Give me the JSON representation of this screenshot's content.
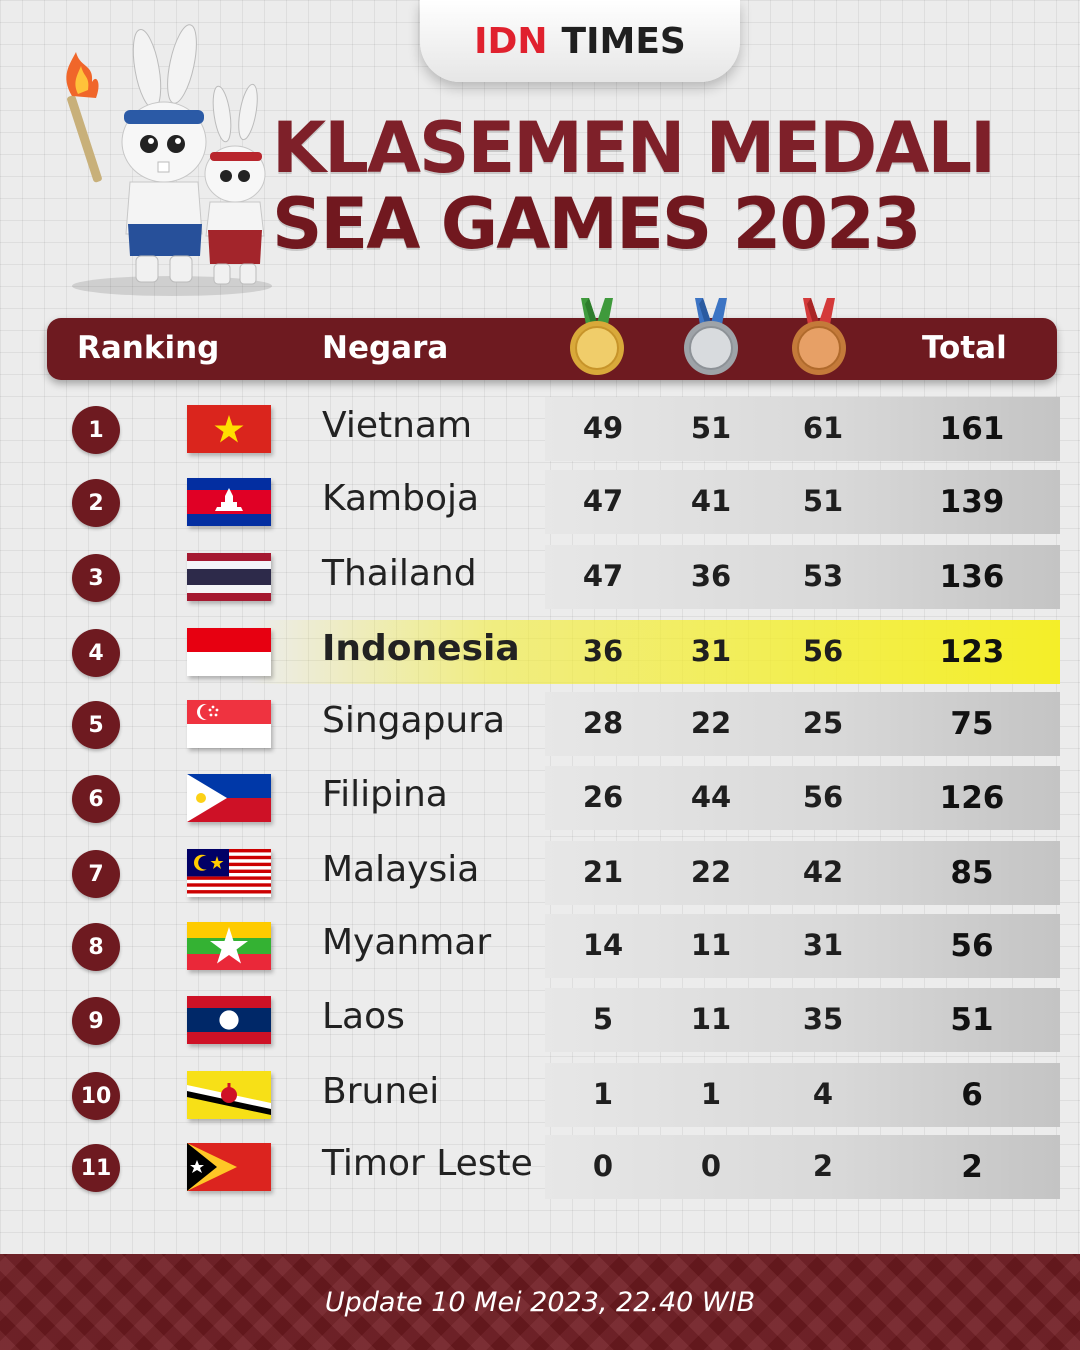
{
  "brand": {
    "part1": "IDN",
    "part2": "TIMES"
  },
  "title": {
    "line1": "KLASEMEN MEDALI",
    "line2": "SEA GAMES 2023"
  },
  "header": {
    "ranking": "Ranking",
    "country": "Negara",
    "total": "Total"
  },
  "medal_icons": [
    "gold-medal-icon",
    "silver-medal-icon",
    "bronze-medal-icon"
  ],
  "rows": [
    {
      "rank": "1",
      "country": "Vietnam",
      "gold": "49",
      "silver": "51",
      "bronze": "61",
      "total": "161",
      "flag": "vietnam-flag-icon"
    },
    {
      "rank": "2",
      "country": "Kamboja",
      "gold": "47",
      "silver": "41",
      "bronze": "51",
      "total": "139",
      "flag": "cambodia-flag-icon"
    },
    {
      "rank": "3",
      "country": "Thailand",
      "gold": "47",
      "silver": "36",
      "bronze": "53",
      "total": "136",
      "flag": "thailand-flag-icon"
    },
    {
      "rank": "4",
      "country": "Indonesia",
      "gold": "36",
      "silver": "31",
      "bronze": "56",
      "total": "123",
      "flag": "indonesia-flag-icon",
      "highlight": true
    },
    {
      "rank": "5",
      "country": "Singapura",
      "gold": "28",
      "silver": "22",
      "bronze": "25",
      "total": "75",
      "flag": "singapore-flag-icon"
    },
    {
      "rank": "6",
      "country": "Filipina",
      "gold": "26",
      "silver": "44",
      "bronze": "56",
      "total": "126",
      "flag": "philippines-flag-icon"
    },
    {
      "rank": "7",
      "country": "Malaysia",
      "gold": "21",
      "silver": "22",
      "bronze": "42",
      "total": "85",
      "flag": "malaysia-flag-icon"
    },
    {
      "rank": "8",
      "country": "Myanmar",
      "gold": "14",
      "silver": "11",
      "bronze": "31",
      "total": "56",
      "flag": "myanmar-flag-icon"
    },
    {
      "rank": "9",
      "country": "Laos",
      "gold": "5",
      "silver": "11",
      "bronze": "35",
      "total": "51",
      "flag": "laos-flag-icon"
    },
    {
      "rank": "10",
      "country": "Brunei",
      "gold": "1",
      "silver": "1",
      "bronze": "4",
      "total": "6",
      "flag": "brunei-flag-icon"
    },
    {
      "rank": "11",
      "country": "Timor Leste",
      "gold": "0",
      "silver": "0",
      "bronze": "2",
      "total": "2",
      "flag": "timor-leste-flag-icon"
    }
  ],
  "footer": {
    "text": "Update 10 Mei 2023, 22.40 WIB"
  },
  "colors": {
    "maroon": "#6e1a20",
    "highlight": "#f4ee28",
    "brand_red": "#e0212e"
  }
}
